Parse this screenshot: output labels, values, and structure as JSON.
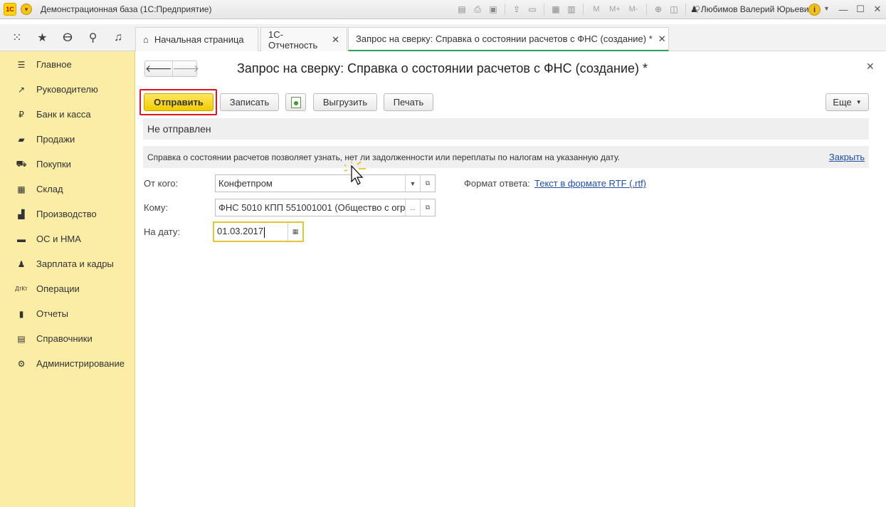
{
  "titlebar": {
    "logo_text": "1С",
    "title": "Демонстрационная база  (1С:Предприятие)",
    "m_label": "M",
    "m_plus_label": "M+",
    "m_minus_label": "M-",
    "user": "Любимов Валерий Юрьевич",
    "info_label": "i"
  },
  "tabs": [
    {
      "label": "Начальная страница"
    },
    {
      "label": "1С-Отчетность"
    },
    {
      "label": "Запрос на сверку: Справка о состоянии расчетов с ФНС (создание) *"
    }
  ],
  "sidebar": {
    "items": [
      {
        "label": "Главное",
        "icon": "hamburger-icon"
      },
      {
        "label": "Руководителю",
        "icon": "trend-icon"
      },
      {
        "label": "Банк и касса",
        "icon": "ruble-icon"
      },
      {
        "label": "Продажи",
        "icon": "bag-icon"
      },
      {
        "label": "Покупки",
        "icon": "cart-icon"
      },
      {
        "label": "Склад",
        "icon": "warehouse-icon"
      },
      {
        "label": "Производство",
        "icon": "factory-icon"
      },
      {
        "label": "ОС и НМА",
        "icon": "truck-icon"
      },
      {
        "label": "Зарплата и кадры",
        "icon": "person-icon"
      },
      {
        "label": "Операции",
        "icon": "dt-kt-icon"
      },
      {
        "label": "Отчеты",
        "icon": "bar-chart-icon"
      },
      {
        "label": "Справочники",
        "icon": "books-icon"
      },
      {
        "label": "Администрирование",
        "icon": "gear-icon"
      }
    ]
  },
  "form": {
    "title": "Запрос на сверку: Справка о состоянии расчетов с ФНС (создание) *",
    "buttons": {
      "send": "Отправить",
      "save": "Записать",
      "export": "Выгрузить",
      "print": "Печать",
      "more": "Еще"
    },
    "status": "Не отправлен",
    "info_text": "Справка о состоянии расчетов позволяет узнать, нет ли задолженности или переплаты по налогам на указанную дату.",
    "info_close": "Закрыть",
    "from_label": "От кого:",
    "from_value": "Конфетпром",
    "to_label": "Кому:",
    "to_value": "ФНС 5010 КПП 551001001 (Общество с огр",
    "to_button": "...",
    "date_label": "На дату:",
    "date_value": "01.03.2017",
    "response_format_label": "Формат ответа:",
    "response_format_value": "Текст в формате RTF (.rtf)"
  }
}
